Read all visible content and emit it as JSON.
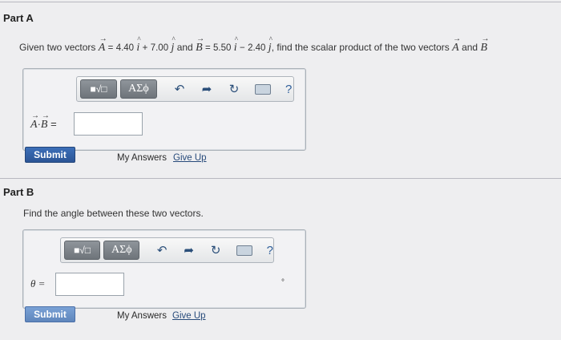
{
  "part_a": {
    "title": "Part A",
    "question": {
      "prefix": "Given two vectors",
      "vec_a": "A",
      "eq": "=",
      "a_i": "4.40",
      "i_unit": "i",
      "plus": "+",
      "a_j": "7.00",
      "j_unit": "j",
      "and_text": "and",
      "vec_b": "B",
      "b_i": "5.50",
      "minus": "−",
      "b_j": "2.40",
      "suffix": ", find the scalar product of the two vectors",
      "end_a": "A",
      "end_and": "and",
      "end_b": "B"
    },
    "answer_label_a": "A",
    "answer_label_dot": "·",
    "answer_label_b": "B",
    "answer_label_eq": "=",
    "input_value": "",
    "submit": "Submit",
    "my_answers": "My Answers",
    "give_up": "Give Up"
  },
  "part_b": {
    "title": "Part B",
    "question": "Find the angle between these two vectors.",
    "answer_label": "θ =",
    "input_value": "",
    "unit": "°",
    "submit": "Submit",
    "my_answers": "My Answers",
    "give_up": "Give Up"
  },
  "toolbar": {
    "template_icon": "■√□",
    "greek": "ΑΣϕ",
    "undo_icon": "↶",
    "redo_icon": "➦",
    "reset_icon": "↻",
    "keyboard_icon": "keyboard-icon",
    "help": "?"
  }
}
